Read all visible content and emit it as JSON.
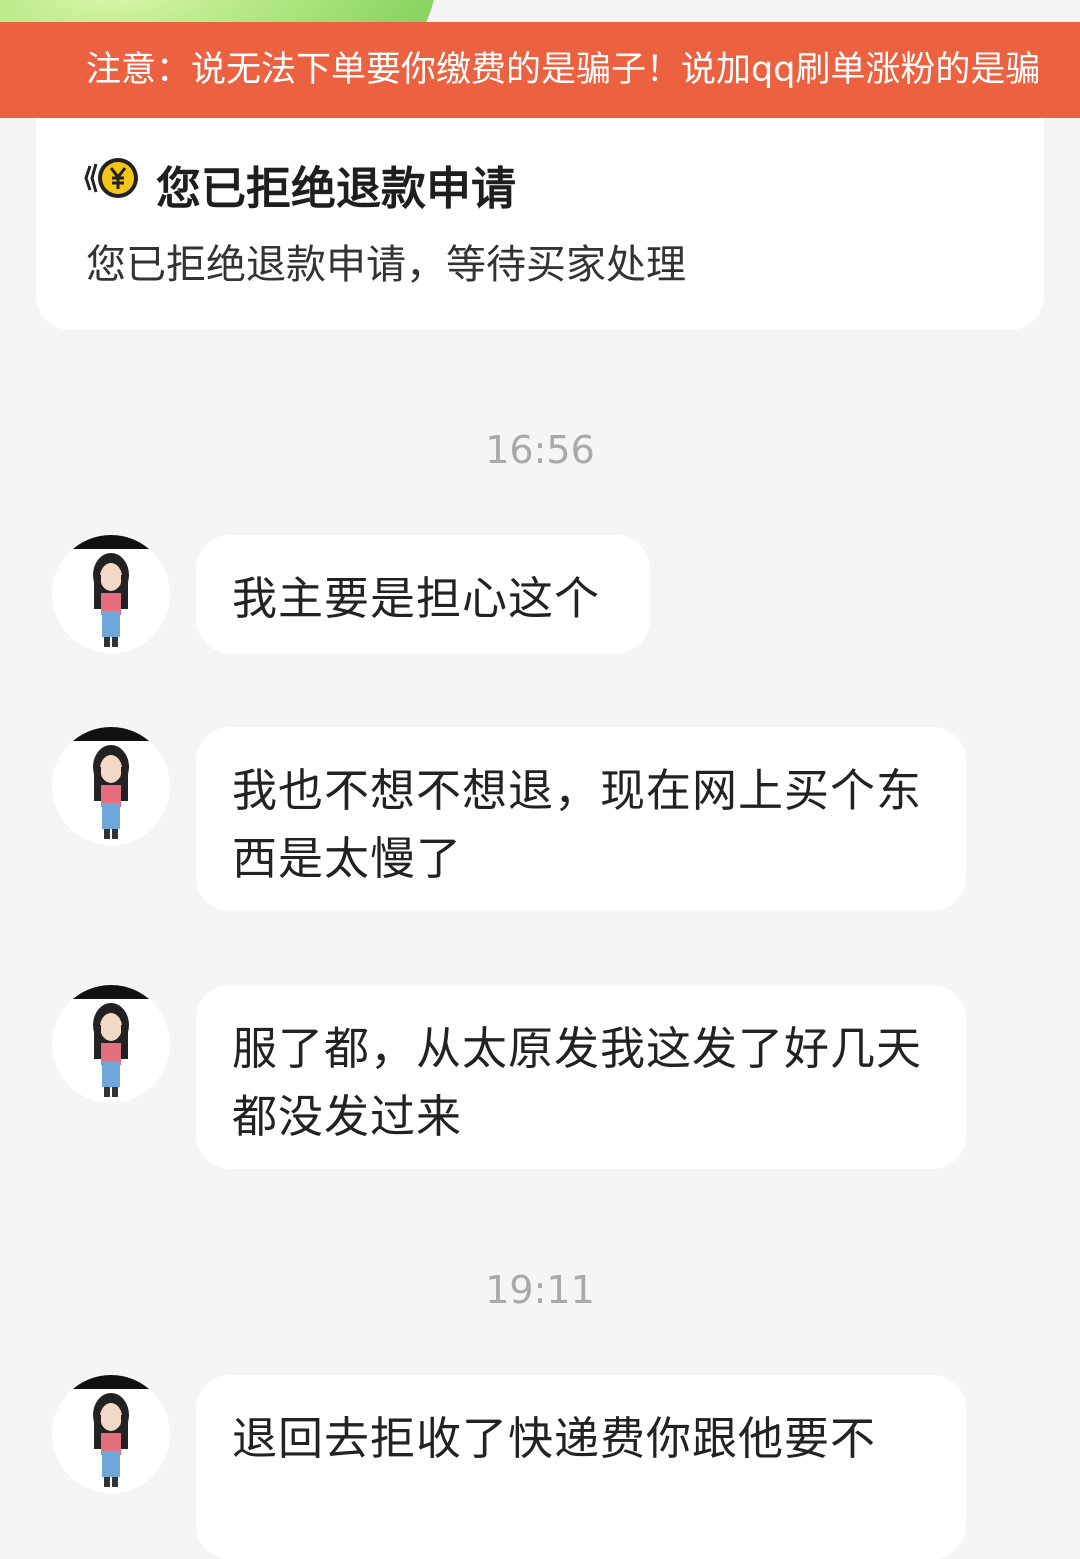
{
  "banner": {
    "warning_text": "注意：说无法下单要你缴费的是骗子！说加qq刷单涨粉的是骗"
  },
  "refund_card": {
    "icon": "yen-coin-icon",
    "title": "您已拒绝退款申请",
    "description": "您已拒绝退款申请，等待买家处理"
  },
  "timestamps": [
    "16:56",
    "19:11"
  ],
  "messages": [
    {
      "text": "我主要是担心这个"
    },
    {
      "text": "我也不想不想退，现在网上买个东西是太慢了"
    },
    {
      "text": "服了都，从太原发我这发了好几天都没发过来"
    },
    {
      "text": "退回去拒收了快递费你跟他要不"
    }
  ],
  "colors": {
    "banner": "#ec6240",
    "background": "#f5f5f5",
    "bubble": "#ffffff",
    "timestamp": "#a9a9a9",
    "coin": "#f5c518"
  }
}
